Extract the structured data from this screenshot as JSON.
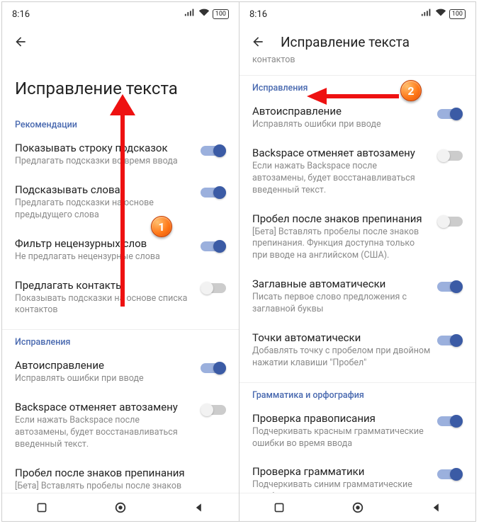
{
  "status": {
    "time": "8:16",
    "battery": "100"
  },
  "left": {
    "page_title": "Исправление текста",
    "sections": {
      "rec": {
        "header": "Рекомендации",
        "items": [
          {
            "title": "Показывать строку подсказок",
            "sub": "Предлагать подсказки во время ввода",
            "on": true
          },
          {
            "title": "Подсказывать слова",
            "sub": "Предлагать подсказки на основе предыдущего слова",
            "on": true
          },
          {
            "title": "Фильтр нецензурных слов",
            "sub": "Не предлагать нецензурные слова",
            "on": true
          },
          {
            "title": "Предлагать контакты",
            "sub": "Показывать подсказки на основе списка контактов",
            "on": false
          }
        ]
      },
      "fix": {
        "header": "Исправления",
        "items": [
          {
            "title": "Автоисправление",
            "sub": "Исправлять ошибки при вводе",
            "on": true
          },
          {
            "title": "Backspace отменяет автозамену",
            "sub": "Если нажать Backspace после автозамены, будет восстанавливаться введенный текст.",
            "on": false
          },
          {
            "title": "Пробел после знаков препинания",
            "sub": "[Бета] Вставлять пробелы после знаков препинания. Функция доступна только при вводе на английском (США).",
            "on": false
          }
        ]
      }
    }
  },
  "right": {
    "toolbar_title": "Исправление текста",
    "trailing": "контактов",
    "sections": {
      "fix": {
        "header": "Исправления",
        "items": [
          {
            "title": "Автоисправление",
            "sub": "Исправлять ошибки при вводе",
            "on": true
          },
          {
            "title": "Backspace отменяет автозамену",
            "sub": "Если нажать Backspace после автозамены, будет восстанавливаться введенный текст.",
            "on": false
          },
          {
            "title": "Пробел после знаков препинания",
            "sub": "[Бета] Вставлять пробелы после знаков препинания. Функция доступна только при вводе на английском (США).",
            "on": false
          },
          {
            "title": "Заглавные автоматически",
            "sub": "Писать первое слово предложения с заглавной буквы",
            "on": true
          },
          {
            "title": "Точки автоматически",
            "sub": "Добавлять точку с пробелом при двойном нажатии клавиши \"Пробел\"",
            "on": true
          }
        ]
      },
      "gram": {
        "header": "Грамматика и орфография",
        "items": [
          {
            "title": "Проверка правописания",
            "sub": "Подчеркивать красным грамматические ошибки во время ввода",
            "on": true
          },
          {
            "title": "Проверка грамматики",
            "sub": "Подчеркивать синим грамматические ошибки во время ввода",
            "on": true
          }
        ]
      }
    }
  },
  "markers": {
    "one": "1",
    "two": "2"
  }
}
